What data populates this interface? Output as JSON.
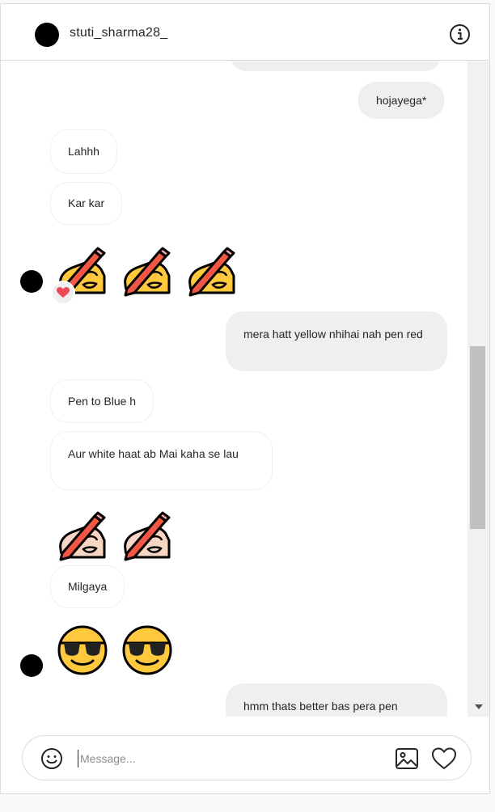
{
  "header": {
    "username": "stuti_sharma28_"
  },
  "messages": {
    "hojayega": "hojayega*",
    "lahhh": "Lahhh",
    "kar_kar": "Kar kar",
    "mera_hatt": "mera hatt yellow nhihai nah pen red",
    "pen_blue": "Pen to Blue h",
    "aur_white": "Aur white haat ab Mai kaha se lau",
    "milgaya": "Milgaya",
    "hmm": "hmm thats better bas pera pen"
  },
  "icons": {
    "writing_hand_yellow": "writing-hand-emoji",
    "writing_hand_light": "writing-hand-light-skin-emoji",
    "sunglasses_face": "smiling-face-with-sunglasses-emoji",
    "reaction": "red-heart-icon",
    "info": "info-icon",
    "emoji_picker": "smiley-icon",
    "image": "image-icon",
    "like": "heart-icon"
  },
  "composer": {
    "placeholder": "Message..."
  },
  "colors": {
    "incoming_bubble_border": "#efefef",
    "outgoing_bubble": "#efefef",
    "reaction_heart": "#ed4956",
    "emoji_yellow": "#ffc83d",
    "emoji_light_skin": "#f7d7c4",
    "pencil_red": "#f15744"
  }
}
